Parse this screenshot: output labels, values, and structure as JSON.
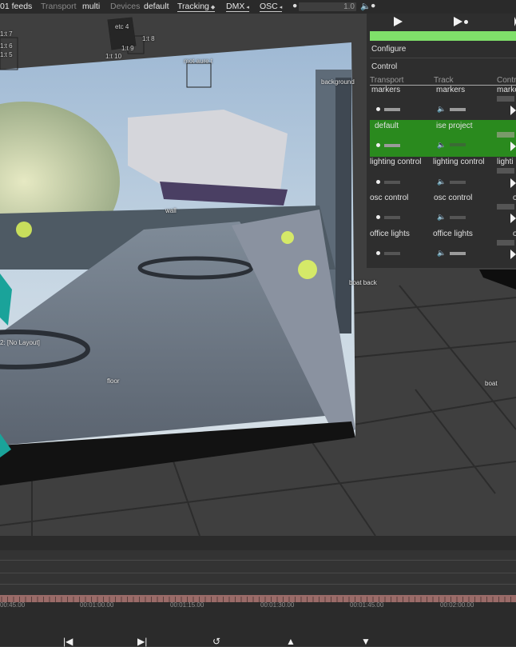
{
  "topbar": {
    "feeds": "01 feeds",
    "transport_label": "Transport",
    "transport_value": "multi",
    "devices_label": "Devices",
    "devices_value": "default",
    "tracking": "Tracking",
    "dmx": "DMX",
    "osc": "OSC",
    "volume": "1.0"
  },
  "viewport": {
    "labels": {
      "etc4": "etc 4",
      "l17": "1:t 7",
      "l16": "1:t 6",
      "l15": "1:t 5",
      "l18": "1:t 8",
      "l19": "1:t 9",
      "l110": "1:t 10",
      "motion": "mot aure t",
      "background": "background",
      "wall": "wall",
      "boat_back": "boat back",
      "no_layout": "2: [No Layout]",
      "floor": "floor",
      "boat": "boat"
    }
  },
  "panel": {
    "configure": "Configure",
    "control": "Control",
    "headers": [
      "Transport",
      "Track",
      "Contr"
    ],
    "rows": [
      {
        "transport": "markers",
        "track": "markers",
        "control": "marke",
        "active": false
      },
      {
        "transport": "default",
        "track": "ise project",
        "control": "",
        "active": true
      },
      {
        "transport": "lighting control",
        "track": "lighting control",
        "control": "lighti",
        "active": false
      },
      {
        "transport": "osc control",
        "track": "osc control",
        "control": "o",
        "active": false
      },
      {
        "transport": "office lights",
        "track": "office lights",
        "control": "o",
        "active": false
      }
    ],
    "colors": {
      "progress": "#7fe06a",
      "active_row": "#2a8a1e"
    }
  },
  "timeline": {
    "ticks": [
      "00:45.00",
      "00:01:00.00",
      "00:01:15.00",
      "00:01:30.00",
      "00:01:45.00",
      "00:02:00.00"
    ]
  }
}
